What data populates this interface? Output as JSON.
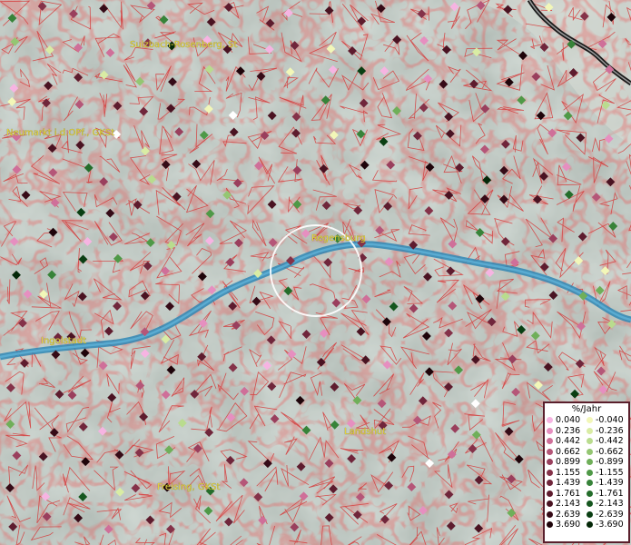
{
  "map": {
    "cities": [
      {
        "name": "Sulzbach-Rosenberg, St"
      },
      {
        "name": "Neumarkt i.d.OPf., GKSt"
      },
      {
        "name": "Regensburg"
      },
      {
        "name": "Ingolstadt"
      },
      {
        "name": "Landshut"
      },
      {
        "name": "Freising, GKSt"
      }
    ]
  },
  "legend": {
    "title": "%/Jahr",
    "positive": [
      {
        "label": "0.040",
        "color": "#f6b4e2"
      },
      {
        "label": "0.236",
        "color": "#e68fc0"
      },
      {
        "label": "0.442",
        "color": "#cf6f99"
      },
      {
        "label": "0.662",
        "color": "#b55678"
      },
      {
        "label": "0.899",
        "color": "#9a3f5d"
      },
      {
        "label": "1.155",
        "color": "#853249"
      },
      {
        "label": "1.439",
        "color": "#70263b"
      },
      {
        "label": "1.761",
        "color": "#5e1c2e"
      },
      {
        "label": "2.143",
        "color": "#4a1322"
      },
      {
        "label": "2.639",
        "color": "#360b17"
      },
      {
        "label": "3.690",
        "color": "#1e040a"
      }
    ],
    "negative": [
      {
        "label": "-0.040",
        "color": "#f2f7b8"
      },
      {
        "label": "-0.236",
        "color": "#d9eca4"
      },
      {
        "label": "-0.442",
        "color": "#b9dc8e"
      },
      {
        "label": "-0.662",
        "color": "#94c672"
      },
      {
        "label": "-0.899",
        "color": "#6faf59"
      },
      {
        "label": "-1.155",
        "color": "#4f9947"
      },
      {
        "label": "-1.439",
        "color": "#378339"
      },
      {
        "label": "-1.761",
        "color": "#246d2b"
      },
      {
        "label": "-2.143",
        "color": "#15561e"
      },
      {
        "label": "-2.639",
        "color": "#0a3f13"
      },
      {
        "label": "-3.690",
        "color": "#042808"
      }
    ]
  }
}
